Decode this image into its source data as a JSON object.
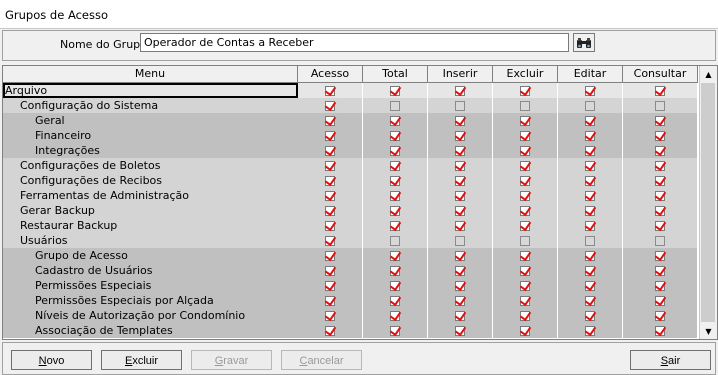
{
  "window": {
    "title": "Grupos de Acesso"
  },
  "group": {
    "label": "Nome do Grupo:",
    "value": "Operador de Contas a Receber"
  },
  "columns": [
    "Menu",
    "Acesso",
    "Total",
    "Inserir",
    "Excluir",
    "Editar",
    "Consultar"
  ],
  "rows": [
    {
      "label": "Arquivo",
      "level": 0,
      "checks": [
        true,
        true,
        true,
        true,
        true,
        true
      ],
      "selected": true
    },
    {
      "label": "Configuração do Sistema",
      "level": 1,
      "checks": [
        true,
        false,
        false,
        false,
        false,
        false
      ]
    },
    {
      "label": "Geral",
      "level": 2,
      "checks": [
        true,
        true,
        true,
        true,
        true,
        true
      ]
    },
    {
      "label": "Financeiro",
      "level": 2,
      "checks": [
        true,
        true,
        true,
        true,
        true,
        true
      ]
    },
    {
      "label": "Integrações",
      "level": 2,
      "checks": [
        true,
        true,
        true,
        true,
        true,
        true
      ]
    },
    {
      "label": "Configurações de Boletos",
      "level": 1,
      "checks": [
        true,
        true,
        true,
        true,
        true,
        true
      ]
    },
    {
      "label": "Configurações de Recibos",
      "level": 1,
      "checks": [
        true,
        true,
        true,
        true,
        true,
        true
      ]
    },
    {
      "label": "Ferramentas de Administração",
      "level": 1,
      "checks": [
        true,
        true,
        true,
        true,
        true,
        true
      ]
    },
    {
      "label": "Gerar Backup",
      "level": 1,
      "checks": [
        true,
        true,
        true,
        true,
        true,
        true
      ]
    },
    {
      "label": "Restaurar Backup",
      "level": 1,
      "checks": [
        true,
        true,
        true,
        true,
        true,
        true
      ]
    },
    {
      "label": "Usuários",
      "level": 1,
      "checks": [
        true,
        false,
        false,
        false,
        false,
        false
      ]
    },
    {
      "label": "Grupo de Acesso",
      "level": 2,
      "checks": [
        true,
        true,
        true,
        true,
        true,
        true
      ]
    },
    {
      "label": "Cadastro de Usuários",
      "level": 2,
      "checks": [
        true,
        true,
        true,
        true,
        true,
        true
      ]
    },
    {
      "label": "Permissões Especiais",
      "level": 2,
      "checks": [
        true,
        true,
        true,
        true,
        true,
        true
      ]
    },
    {
      "label": "Permissões Especiais por Alçada",
      "level": 2,
      "checks": [
        true,
        true,
        true,
        true,
        true,
        true
      ]
    },
    {
      "label": "Níveis de Autorização por Condomínio",
      "level": 2,
      "checks": [
        true,
        true,
        true,
        true,
        true,
        true
      ]
    },
    {
      "label": "Associação de Templates",
      "level": 2,
      "checks": [
        true,
        true,
        true,
        true,
        true,
        true
      ]
    }
  ],
  "buttons": {
    "novo": {
      "label": "Novo",
      "enabled": true
    },
    "excluir": {
      "label": "Excluir",
      "enabled": true
    },
    "gravar": {
      "label": "Gravar",
      "enabled": false
    },
    "cancelar": {
      "label": "Cancelar",
      "enabled": false
    },
    "sair": {
      "label": "Sair",
      "enabled": true
    }
  },
  "colors": {
    "check": "#dd1111",
    "selection_border": "#000000"
  },
  "icons": {
    "find": "binoculars-icon",
    "scroll_up": "arrow-up-icon",
    "scroll_down": "arrow-down-icon"
  }
}
